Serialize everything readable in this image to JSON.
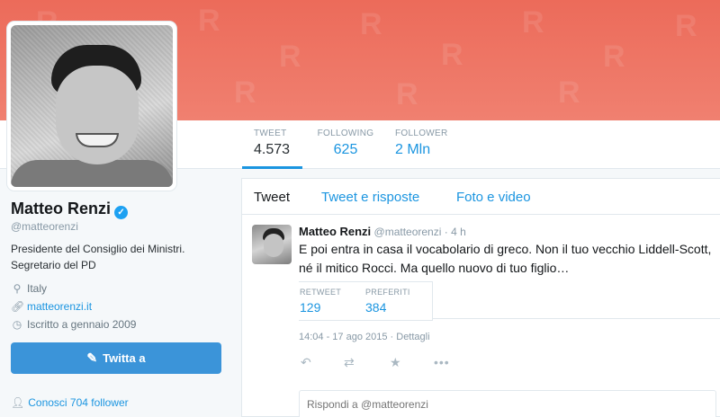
{
  "colors": {
    "accent": "#1b95e0",
    "banner": "#ec6b5a",
    "button": "#3b94d9"
  },
  "nav": {
    "stats": [
      {
        "label": "TWEET",
        "value": "4.573"
      },
      {
        "label": "FOLLOWING",
        "value": "625"
      },
      {
        "label": "FOLLOWER",
        "value": "2 Mln"
      }
    ]
  },
  "profile": {
    "name": "Matteo Renzi",
    "handle": "@matteorenzi",
    "bio": "Presidente del Consiglio dei Ministri. Segretario del PD",
    "location": "Italy",
    "url": "matteorenzi.it",
    "joined": "Iscritto a gennaio 2009",
    "tweet_button": "Twitta a",
    "followers_link": "Conosci 704 follower",
    "icons": {
      "verified": "verified-check-icon",
      "location": "location-pin-icon",
      "url": "link-icon",
      "joined": "calendar-icon",
      "tweet": "compose-icon",
      "followers": "person-icon"
    }
  },
  "timeline": {
    "tabs": [
      "Tweet",
      "Tweet e risposte",
      "Foto e video"
    ],
    "tweet": {
      "name": "Matteo Renzi",
      "handle": "@matteorenzi",
      "time": "· 4 h",
      "text": "E poi entra in casa il vocabolario di greco. Non il tuo vecchio Liddell-Scott, né il mitico Rocci. Ma quello nuovo di tuo figlio…",
      "retweet_label": "RETWEET",
      "retweet_count": "129",
      "fav_label": "PREFERITI",
      "fav_count": "384",
      "date": "14:04 - 17 ago 2015 · Dettagli",
      "actions": {
        "reply": "reply-icon",
        "retweet": "retweet-icon",
        "favorite": "star-icon",
        "more": "more-icon"
      }
    },
    "reply_placeholder": "Rispondi a @matteorenzi"
  }
}
